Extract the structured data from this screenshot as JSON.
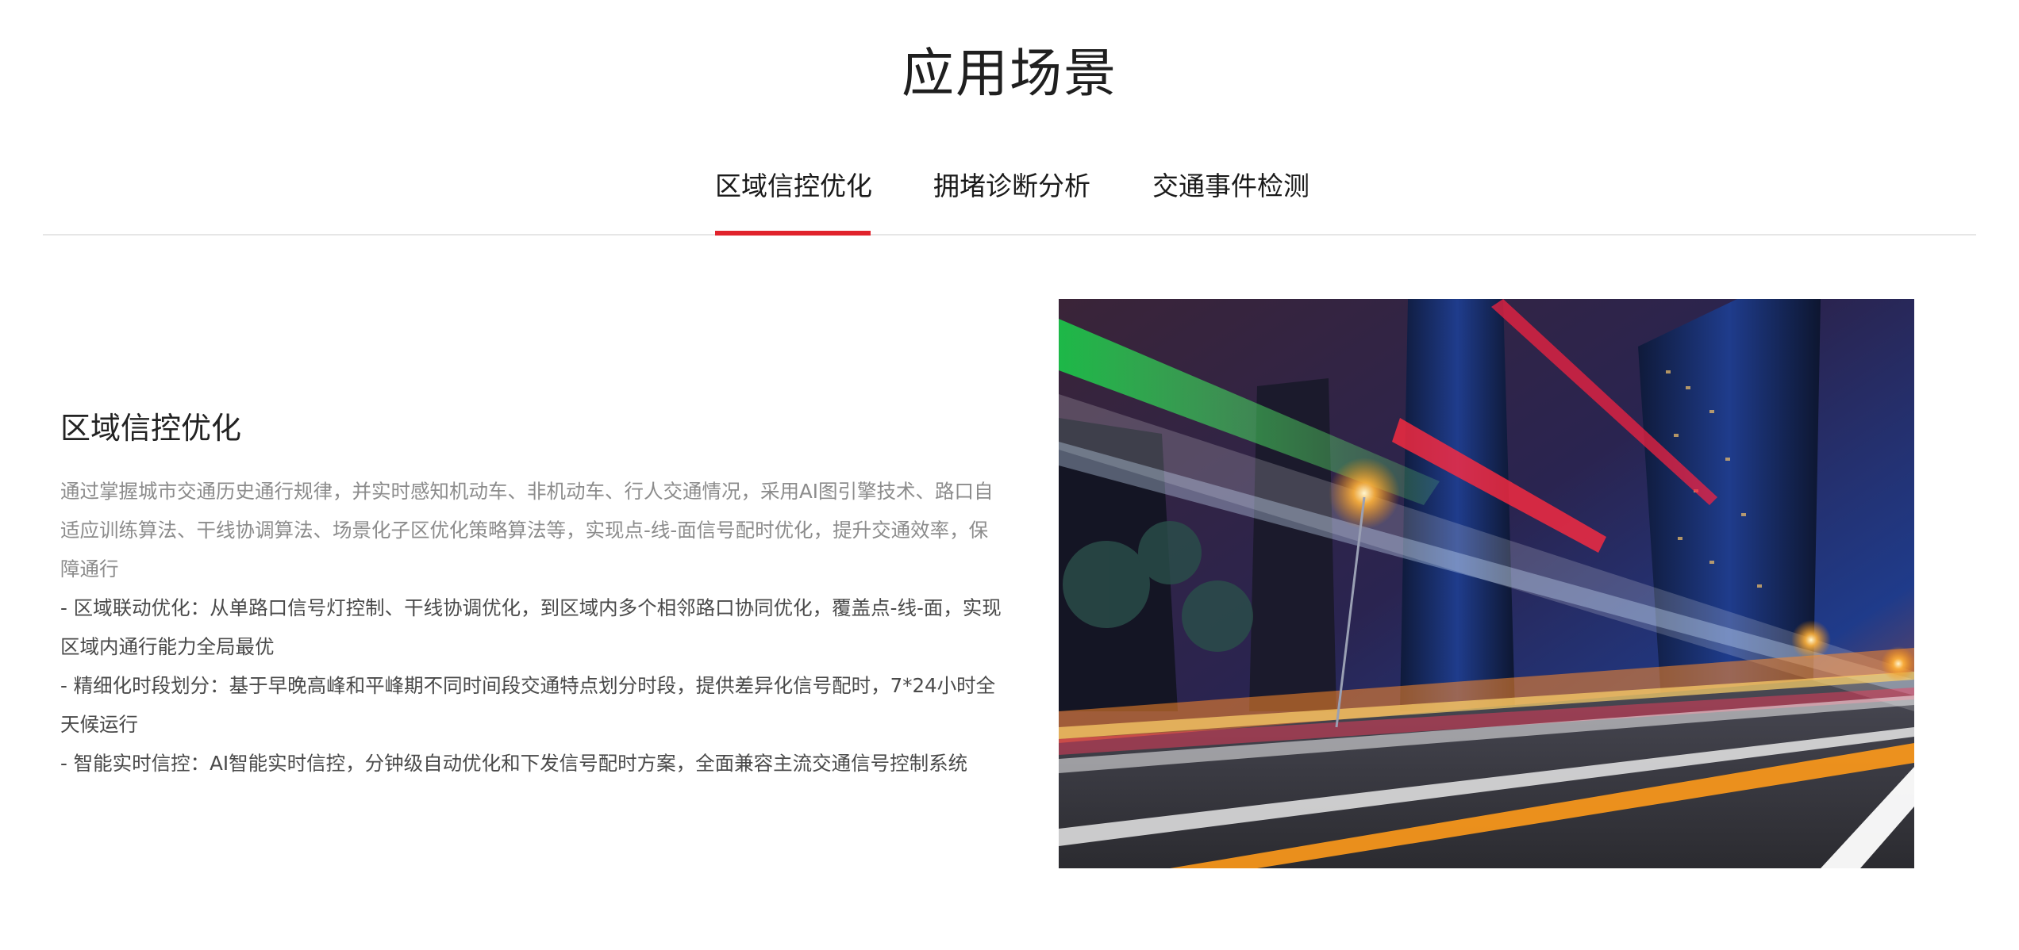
{
  "header": {
    "title": "应用场景"
  },
  "tabs": [
    {
      "label": "区域信控优化",
      "active": true
    },
    {
      "label": "拥堵诊断分析",
      "active": false
    },
    {
      "label": "交通事件检测",
      "active": false
    }
  ],
  "content": {
    "title": "区域信控优化",
    "description": "通过掌握城市交通历史通行规律，并实时感知机动车、非机动车、行人交通情况，采用AI图引擎技术、路口自适应训练算法、干线协调算法、场景化子区优化策略算法等，实现点-线-面信号配时优化，提升交通效率，保障通行",
    "points": [
      "- 区域联动优化：从单路口信号灯控制、干线协调优化，到区域内多个相邻路口协同优化，覆盖点-线-面，实现区域内通行能力全局最优",
      "- 精细化时段划分：基于早晚高峰和平峰期不同时间段交通特点划分时段，提供差异化信号配时，7*24小时全天候运行",
      "- 智能实时信控：AI智能实时信控，分钟级自动优化和下发信号配时方案，全面兼容主流交通信号控制系统"
    ]
  },
  "colors": {
    "accent": "#e1232c",
    "description_text": "#8c8c8c",
    "point_text": "#4a4a4a",
    "divider": "#e6e6e6"
  }
}
